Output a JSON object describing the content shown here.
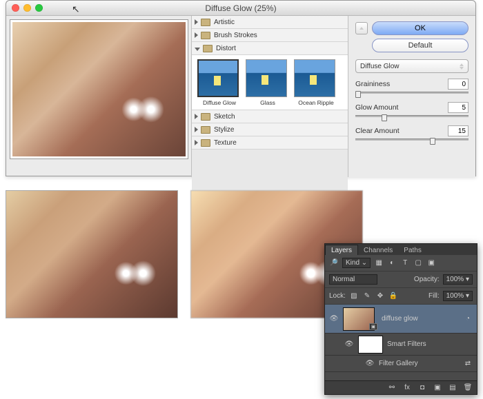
{
  "window": {
    "title": "Diffuse Glow (25%)"
  },
  "categories": {
    "artistic": "Artistic",
    "brush": "Brush Strokes",
    "distort": "Distort",
    "sketch": "Sketch",
    "stylize": "Stylize",
    "texture": "Texture"
  },
  "thumbs": {
    "diffuse": "Diffuse Glow",
    "glass": "Glass",
    "ocean": "Ocean Ripple"
  },
  "controls": {
    "ok": "OK",
    "default": "Default",
    "filter_name": "Diffuse Glow",
    "graininess_label": "Graininess",
    "graininess_value": "0",
    "glow_label": "Glow Amount",
    "glow_value": "5",
    "clear_label": "Clear Amount",
    "clear_value": "15"
  },
  "layers_panel": {
    "tab_layers": "Layers",
    "tab_channels": "Channels",
    "tab_paths": "Paths",
    "kind": "Kind",
    "blend": "Normal",
    "opacity_label": "Opacity:",
    "opacity_value": "100%",
    "lock_label": "Lock:",
    "fill_label": "Fill:",
    "fill_value": "100%",
    "layer_name": "diffuse glow",
    "smart_filters": "Smart Filters",
    "filter_gallery": "Filter Gallery"
  }
}
